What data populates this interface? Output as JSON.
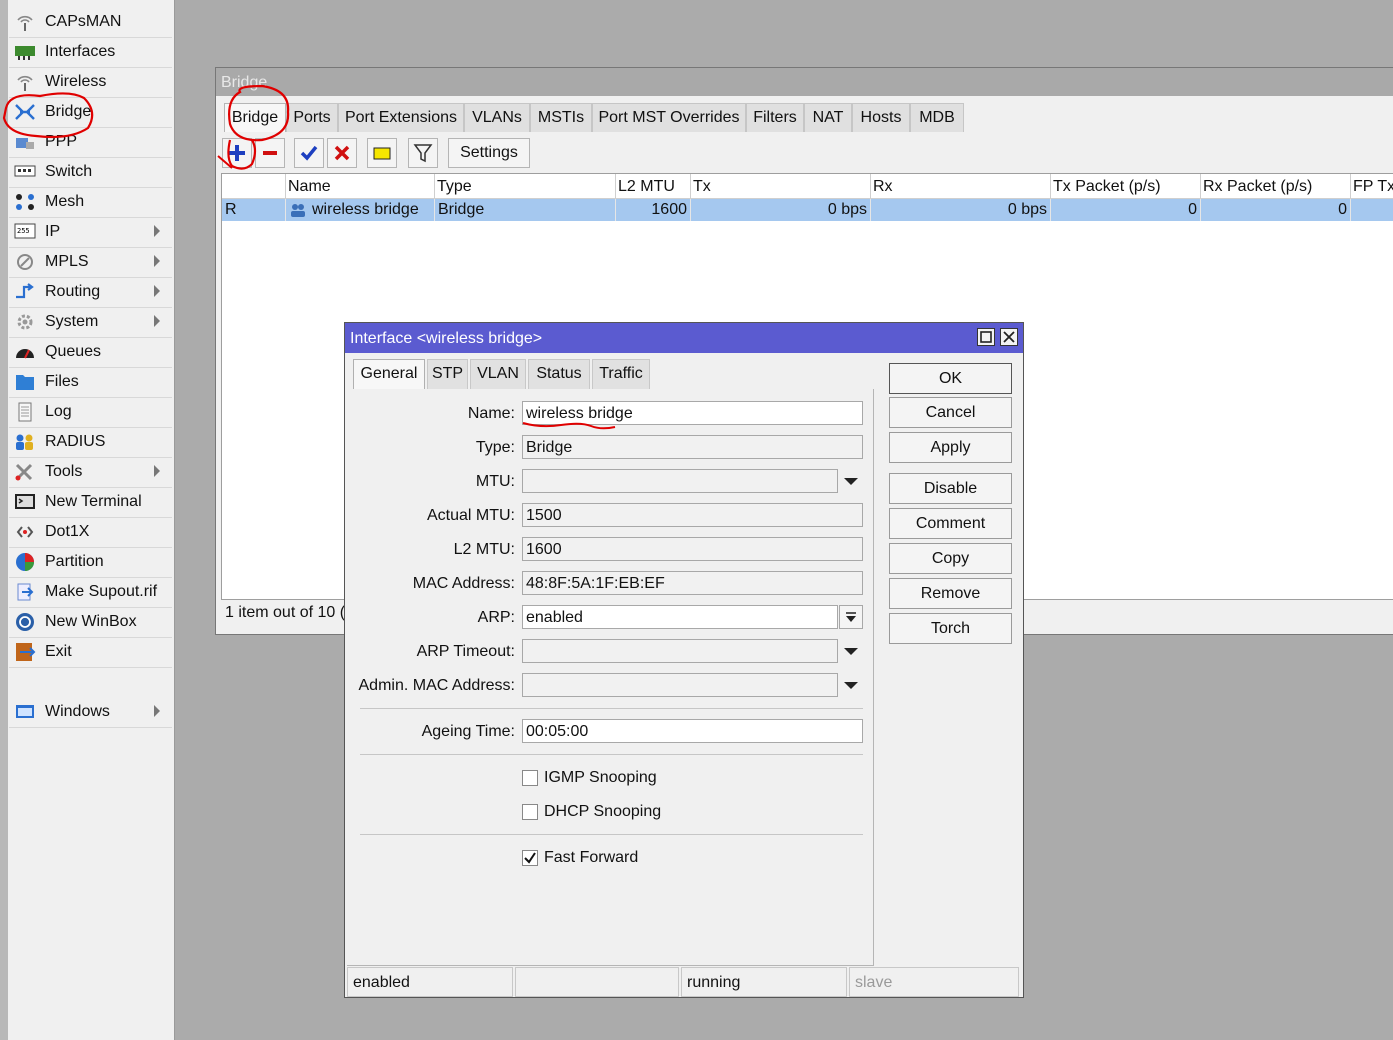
{
  "sidebar": {
    "items": [
      {
        "label": "CAPsMAN",
        "icon": "antenna-icon"
      },
      {
        "label": "Interfaces",
        "icon": "network-card-icon"
      },
      {
        "label": "Wireless",
        "icon": "antenna-icon"
      },
      {
        "label": "Bridge",
        "icon": "bridge-icon"
      },
      {
        "label": "PPP",
        "icon": "ppp-icon"
      },
      {
        "label": "Switch",
        "icon": "switch-icon"
      },
      {
        "label": "Mesh",
        "icon": "mesh-icon"
      },
      {
        "label": "IP",
        "icon": "ip-icon",
        "submenu": true
      },
      {
        "label": "MPLS",
        "icon": "mpls-icon",
        "submenu": true
      },
      {
        "label": "Routing",
        "icon": "routing-icon",
        "submenu": true
      },
      {
        "label": "System",
        "icon": "gear-icon",
        "submenu": true
      },
      {
        "label": "Queues",
        "icon": "queues-icon"
      },
      {
        "label": "Files",
        "icon": "folder-icon"
      },
      {
        "label": "Log",
        "icon": "log-icon"
      },
      {
        "label": "RADIUS",
        "icon": "users-icon"
      },
      {
        "label": "Tools",
        "icon": "tools-icon",
        "submenu": true
      },
      {
        "label": "New Terminal",
        "icon": "terminal-icon"
      },
      {
        "label": "Dot1X",
        "icon": "dot1x-icon"
      },
      {
        "label": "Partition",
        "icon": "pie-icon"
      },
      {
        "label": "Make Supout.rif",
        "icon": "supout-icon"
      },
      {
        "label": "New WinBox",
        "icon": "winbox-icon"
      },
      {
        "label": "Exit",
        "icon": "exit-icon"
      }
    ],
    "windows": {
      "label": "Windows",
      "icon": "window-icon",
      "submenu": true
    }
  },
  "bridge_window": {
    "title": "Bridge",
    "tabs": [
      "Bridge",
      "Ports",
      "Port Extensions",
      "VLANs",
      "MSTIs",
      "Port MST Overrides",
      "Filters",
      "NAT",
      "Hosts",
      "MDB"
    ],
    "toolbar": {
      "settings_label": "Settings"
    },
    "columns": [
      "Name",
      "Type",
      "L2 MTU",
      "Tx",
      "Rx",
      "Tx Packet (p/s)",
      "Rx Packet (p/s)",
      "FP Tx"
    ],
    "rows": [
      {
        "flag": "R",
        "name": "wireless bridge",
        "type": "Bridge",
        "l2mtu": "1600",
        "tx": "0 bps",
        "rx": "0 bps",
        "txp": "0",
        "rxp": "0"
      }
    ],
    "status": "1 item out of 10 ("
  },
  "dialog": {
    "title": "Interface <wireless bridge>",
    "tabs": [
      "General",
      "STP",
      "VLAN",
      "Status",
      "Traffic"
    ],
    "fields": {
      "name": {
        "label": "Name:",
        "value": "wireless bridge"
      },
      "type": {
        "label": "Type:",
        "value": "Bridge"
      },
      "mtu": {
        "label": "MTU:",
        "value": ""
      },
      "actual_mtu": {
        "label": "Actual MTU:",
        "value": "1500"
      },
      "l2mtu": {
        "label": "L2 MTU:",
        "value": "1600"
      },
      "mac": {
        "label": "MAC Address:",
        "value": "48:8F:5A:1F:EB:EF"
      },
      "arp": {
        "label": "ARP:",
        "value": "enabled"
      },
      "arp_timeout": {
        "label": "ARP Timeout:",
        "value": ""
      },
      "admin_mac": {
        "label": "Admin. MAC Address:",
        "value": ""
      },
      "ageing": {
        "label": "Ageing Time:",
        "value": "00:05:00"
      }
    },
    "checkboxes": {
      "igmp": {
        "label": "IGMP Snooping",
        "checked": false
      },
      "dhcp": {
        "label": "DHCP Snooping",
        "checked": false
      },
      "fast_forward": {
        "label": "Fast Forward",
        "checked": true
      }
    },
    "buttons": {
      "ok": "OK",
      "cancel": "Cancel",
      "apply": "Apply",
      "disable": "Disable",
      "comment": "Comment",
      "copy": "Copy",
      "remove": "Remove",
      "torch": "Torch"
    },
    "status": [
      "enabled",
      "",
      "running",
      "slave"
    ]
  },
  "colors": {
    "title_active": "#5b5bd0",
    "row_selected": "#a5c8ef",
    "annotation": "#e00000"
  }
}
